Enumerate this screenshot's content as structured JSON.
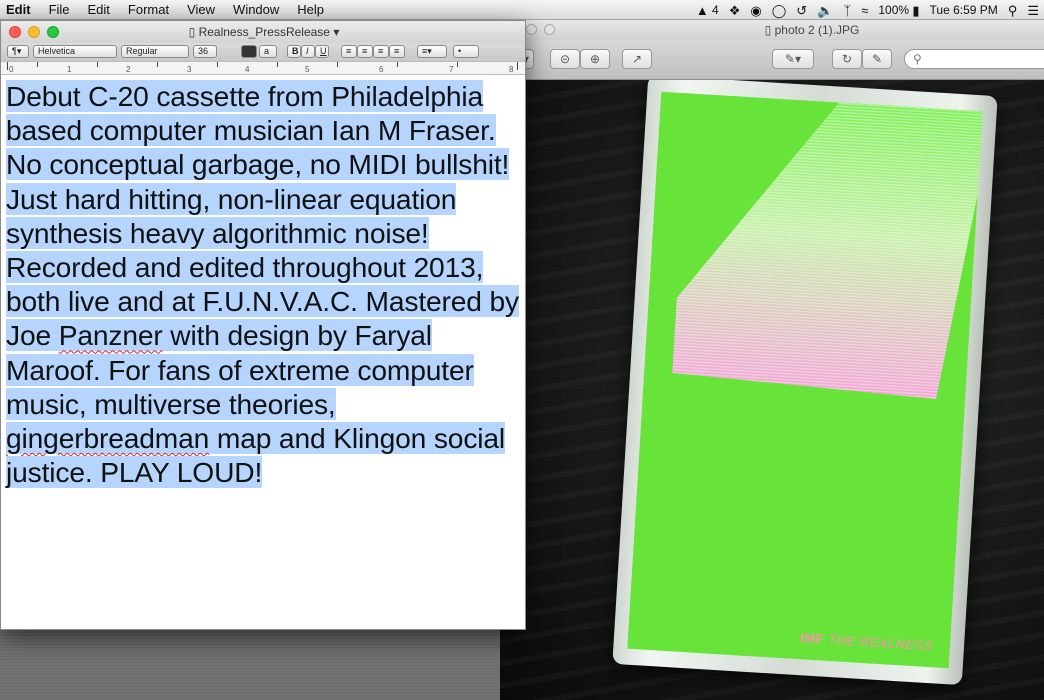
{
  "menubar": {
    "items": [
      "Edit",
      "File",
      "Edit",
      "Format",
      "View",
      "Window",
      "Help"
    ],
    "status": {
      "badge_count": "4",
      "battery": "100%",
      "clock": "Tue 6:59 PM"
    }
  },
  "preview": {
    "title": "photo 2 (1).JPG",
    "cassette_caption_artist": "IMF",
    "cassette_caption_title": "THE REALNESS"
  },
  "textedit": {
    "title": "Realness_PressRelease",
    "toolbar": {
      "font_family": "Helvetica",
      "font_style": "Regular",
      "font_size": "36",
      "bold": "B",
      "italic": "I",
      "underline": "U",
      "list": "•"
    },
    "ruler_numbers": [
      "0",
      "1",
      "2",
      "3",
      "4",
      "5",
      "6",
      "7",
      "8"
    ],
    "document_text_before_panzner": "Debut C-20 cassette from Philadelphia based computer musician Ian M Fraser. No conceptual garbage, no MIDI bullshit! Just hard hitting, non-linear equation synthesis heavy algorithmic noise! Recorded and edited throughout 2013, both live and at F.U.N.V.A.C. Mastered by Joe ",
    "word_panzner": "Panzner",
    "document_text_mid": " with design by Faryal Maroof. For fans of extreme computer music, multiverse theories, ",
    "word_gingerbreadman": "gingerbreadman",
    "document_text_end": " map and Klingon social justice. PLAY LOUD!"
  },
  "colors": {
    "selection": "#b5d5ff",
    "cassette_green": "#68e33a",
    "cassette_pink": "#ff8fb3"
  }
}
